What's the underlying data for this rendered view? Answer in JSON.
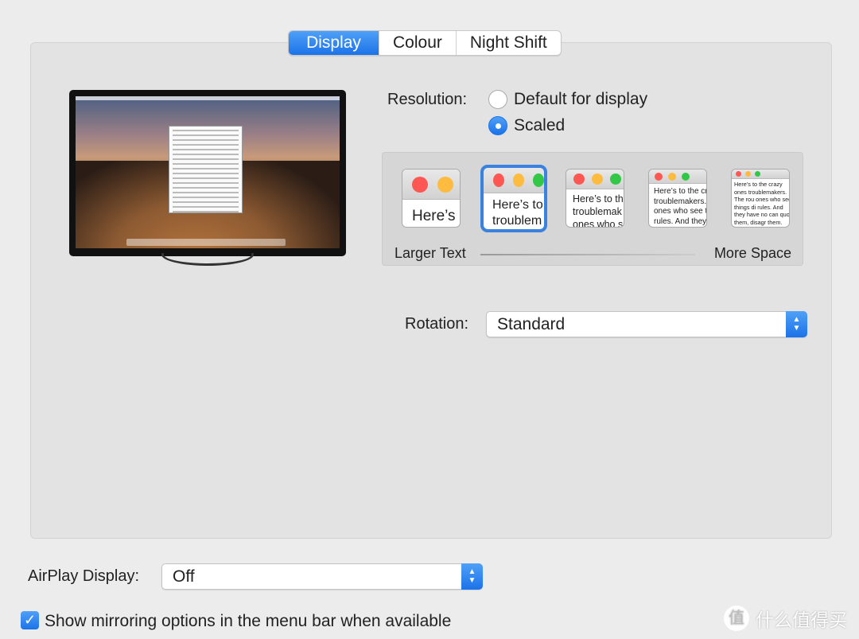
{
  "tabs": [
    {
      "label": "Display",
      "active": true
    },
    {
      "label": "Colour"
    },
    {
      "label": "Night Shift"
    }
  ],
  "resolution": {
    "label": "Resolution:",
    "options": [
      {
        "label": "Default for display",
        "selected": false
      },
      {
        "label": "Scaled",
        "selected": true
      }
    ]
  },
  "scaling": {
    "selected_index": 1,
    "min_label": "Larger Text",
    "max_label": "More Space",
    "previews": [
      "Here’s",
      "Here’s to troublem",
      "Here’s to th troublemak ones who s",
      "Here’s to the cr troublemakers. ones who see t rules. And they",
      "Here’s to the crazy ones troublemakers. The rou ones who see things di rules. And they have no can quote them, disagr them. About the only th Because they change th"
    ]
  },
  "rotation": {
    "label": "Rotation:",
    "value": "Standard"
  },
  "airplay": {
    "label": "AirPlay Display:",
    "value": "Off"
  },
  "mirroring": {
    "label": "Show mirroring options in the menu bar when available",
    "checked": true
  },
  "watermark": {
    "logo": "值",
    "text": "什么值得买"
  },
  "colors": {
    "accent": "#1c73e8",
    "red": "#fc5753",
    "yellow": "#fdbc40",
    "green": "#33c748"
  }
}
